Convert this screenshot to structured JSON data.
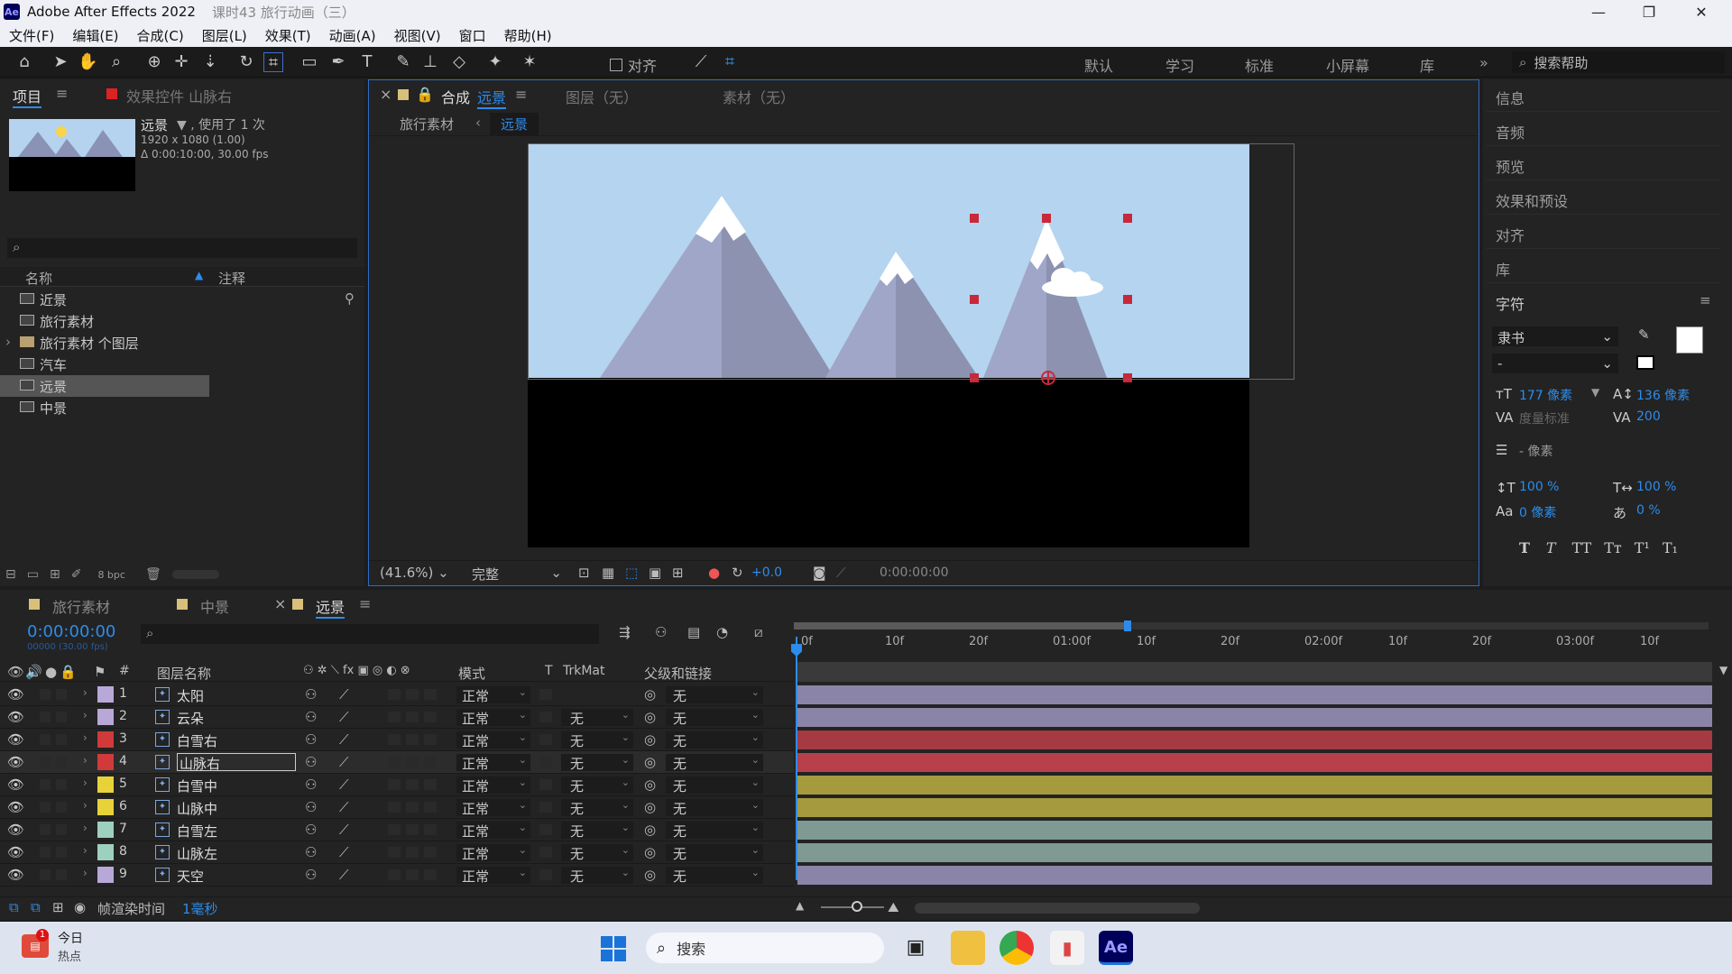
{
  "window": {
    "app_title": "Adobe After Effects 2022",
    "doc_title": "课时43 旅行动画（三）",
    "logo": "Ae"
  },
  "menu": [
    "文件(F)",
    "编辑(E)",
    "合成(C)",
    "图层(L)",
    "效果(T)",
    "动画(A)",
    "视图(V)",
    "窗口",
    "帮助(H)"
  ],
  "toolbar": {
    "snap_label": "对齐",
    "workspaces": [
      "默认",
      "学习",
      "标准",
      "小屏幕",
      "库"
    ],
    "search_placeholder": "搜索帮助"
  },
  "project": {
    "tab_project": "项目",
    "tab_effects": "效果控件 山脉右",
    "item_name": "远景",
    "used": "▼ , 使用了 1 次",
    "dims": "1920 x 1080 (1.00)",
    "duration": "Δ 0:00:10:00, 30.00 fps",
    "col_name": "名称",
    "col_comment": "注释",
    "items": [
      {
        "name": "近景",
        "icon": "composition-icon"
      },
      {
        "name": "旅行素材",
        "icon": "composition-icon"
      },
      {
        "name": "旅行素材 个图层",
        "icon": "folder-icon"
      },
      {
        "name": "汽车",
        "icon": "composition-icon"
      },
      {
        "name": "远景",
        "icon": "composition-icon",
        "selected": true
      },
      {
        "name": "中景",
        "icon": "composition-icon"
      }
    ],
    "bpc": "8 bpc"
  },
  "viewer": {
    "tab_comp_prefix": "合成",
    "tab_comp_name": "远景",
    "tab_layer": "图层（无）",
    "tab_footage": "素材（无）",
    "crumb_parent": "旅行素材",
    "crumb_current": "远景",
    "zoom": "(41.6%)",
    "quality": "完整",
    "exposure": "+0.0",
    "timecode": "0:00:00:00"
  },
  "right_panel": {
    "items": [
      "信息",
      "音频",
      "预览",
      "效果和预设",
      "对齐",
      "库"
    ],
    "character_title": "字符",
    "font_family": "隶书",
    "font_style": "-",
    "font_size": "177 像素",
    "leading": "136 像素",
    "kerning": "度量标准",
    "tracking": "200",
    "line_spacing": "- 像素",
    "vscale": "100 %",
    "hscale": "100 %",
    "baseline": "0 像素",
    "tsume": "0 %"
  },
  "timeline": {
    "tabs": [
      "旅行素材",
      "中景",
      "远景"
    ],
    "timecode": "0:00:00:00",
    "timecode_sub": "00000 (30.00 fps)",
    "headers": {
      "num": "#",
      "name": "图层名称",
      "mode": "模式",
      "t": "T",
      "trkmat": "TrkMat",
      "parent": "父级和链接"
    },
    "ruler": [
      "0f",
      "10f",
      "20f",
      "01:00f",
      "10f",
      "20f",
      "02:00f",
      "10f",
      "20f",
      "03:00f",
      "10f"
    ],
    "layers": [
      {
        "num": "1",
        "name": "太阳",
        "color": "#b8a8d8",
        "mode": "正常",
        "trkmat": "",
        "parent": "无",
        "bar": "#8a85a8"
      },
      {
        "num": "2",
        "name": "云朵",
        "color": "#b8a8d8",
        "mode": "正常",
        "trkmat": "无",
        "parent": "无",
        "bar": "#8a85a8"
      },
      {
        "num": "3",
        "name": "白雪右",
        "color": "#d03a3a",
        "mode": "正常",
        "trkmat": "无",
        "parent": "无",
        "bar": "#a53a42"
      },
      {
        "num": "4",
        "name": "山脉右",
        "color": "#d03a3a",
        "mode": "正常",
        "trkmat": "无",
        "parent": "无",
        "bar": "#b8404a",
        "selected": true
      },
      {
        "num": "5",
        "name": "白雪中",
        "color": "#e8d23a",
        "mode": "正常",
        "trkmat": "无",
        "parent": "无",
        "bar": "#a59a3e"
      },
      {
        "num": "6",
        "name": "山脉中",
        "color": "#e8d23a",
        "mode": "正常",
        "trkmat": "无",
        "parent": "无",
        "bar": "#a59a3e"
      },
      {
        "num": "7",
        "name": "白雪左",
        "color": "#9ed0c0",
        "mode": "正常",
        "trkmat": "无",
        "parent": "无",
        "bar": "#7f9a92"
      },
      {
        "num": "8",
        "name": "山脉左",
        "color": "#9ed0c0",
        "mode": "正常",
        "trkmat": "无",
        "parent": "无",
        "bar": "#7f9a92"
      },
      {
        "num": "9",
        "name": "天空",
        "color": "#b8a8d8",
        "mode": "正常",
        "trkmat": "无",
        "parent": "无",
        "bar": "#8a85a8"
      }
    ],
    "render_label": "帧渲染时间",
    "render_value": "1毫秒"
  },
  "taskbar": {
    "news_title": "今日",
    "news_sub": "热点",
    "search_label": "搜索",
    "badge": "1"
  }
}
